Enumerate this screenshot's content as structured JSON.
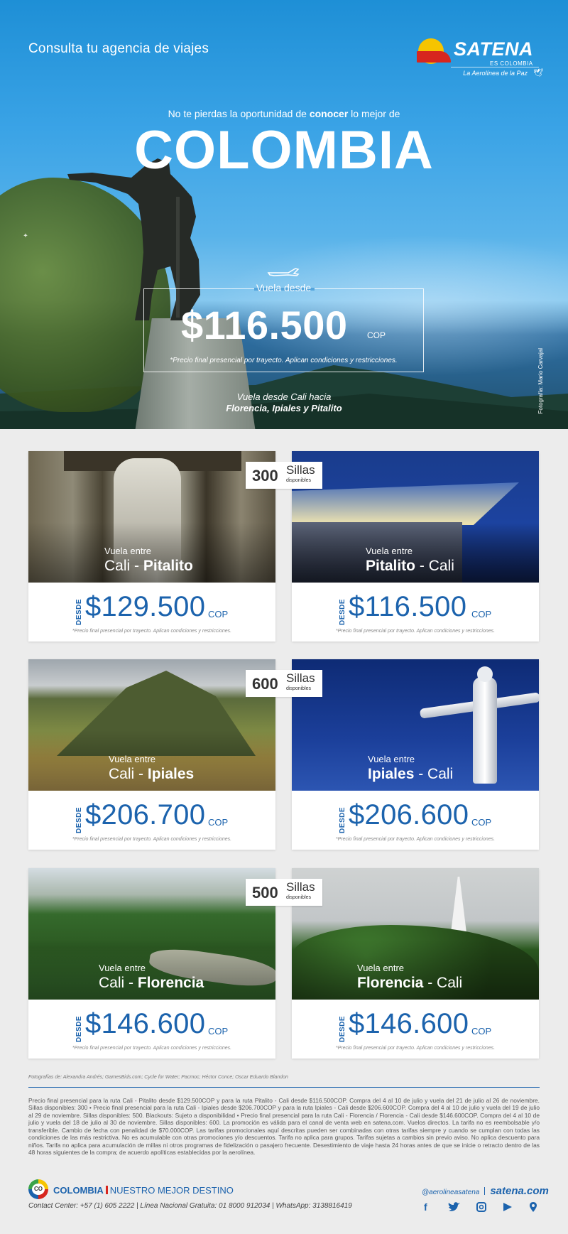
{
  "header": {
    "consulta": "Consulta tu agencia de viajes",
    "logo": {
      "name": "SATENA",
      "sub": "ES COLOMBIA",
      "tagline": "La Aerolínea de la Paz"
    },
    "subtitle_pre": "No te pierdas la oportunidad de ",
    "subtitle_bold": "conocer",
    "subtitle_post": " lo mejor de",
    "title": "COLOMBIA"
  },
  "hero_price": {
    "label": "Vuela desde",
    "amount": "$116.500",
    "currency": "COP",
    "note": "*Precio final presencial por trayecto. Aplican condiciones y restricciones.",
    "route_intro": "Vuela desde Cali hacia",
    "route_cities": "Florencia, Ipiales y Pitalito",
    "photo_credit": "Fotografía: Mario Carvajal"
  },
  "seats": [
    {
      "number": "300",
      "label": "Sillas",
      "sub": "disponibles"
    },
    {
      "number": "600",
      "label": "Sillas",
      "sub": "disponibles"
    },
    {
      "number": "500",
      "label": "Sillas",
      "sub": "disponibles"
    }
  ],
  "cards": [
    {
      "intro": "Vuela entre",
      "from": "Cali",
      "dash": " - ",
      "to": "Pitalito",
      "bold": "to",
      "desde": "DESDE",
      "price": "$129.500",
      "currency": "COP",
      "note": "*Precio final presencial por trayecto. Aplican condiciones y restricciones."
    },
    {
      "intro": "Vuela entre",
      "from": "Pitalito",
      "dash": " - ",
      "to": "Cali",
      "bold": "from",
      "desde": "DESDE",
      "price": "$116.500",
      "currency": "COP",
      "note": "*Precio final presencial por trayecto. Aplican condiciones y restricciones."
    },
    {
      "intro": "Vuela entre",
      "from": "Cali",
      "dash": " - ",
      "to": "Ipiales",
      "bold": "to",
      "desde": "DESDE",
      "price": "$206.700",
      "currency": "COP",
      "note": "*Precio final presencial por trayecto. Aplican condiciones y restricciones."
    },
    {
      "intro": "Vuela entre",
      "from": "Ipiales",
      "dash": " - ",
      "to": "Cali",
      "bold": "from",
      "desde": "DESDE",
      "price": "$206.600",
      "currency": "COP",
      "note": "*Precio final presencial por trayecto. Aplican condiciones y restricciones."
    },
    {
      "intro": "Vuela entre",
      "from": "Cali",
      "dash": " - ",
      "to": "Florencia",
      "bold": "to",
      "desde": "DESDE",
      "price": "$146.600",
      "currency": "COP",
      "note": "*Precio final presencial por trayecto. Aplican condiciones y restricciones."
    },
    {
      "intro": "Vuela entre",
      "from": "Florencia",
      "dash": " - ",
      "to": "Cali",
      "bold": "from",
      "desde": "DESDE",
      "price": "$146.600",
      "currency": "COP",
      "note": "*Precio final presencial por trayecto. Aplican condiciones y restricciones."
    }
  ],
  "footer": {
    "photos_credit": "Fotografías de: Alexandra Andrés; GamesBids.com; Cycle for Water; Pacmoc; Héctor Conce; Oscar Eduardo Blandon",
    "legal": "Precio final presencial para la ruta Cali - Pitalito desde $129.500COP y para la ruta Pitalito - Cali desde $116.500COP. Compra del 4 al 10 de julio y vuela del 21 de julio al 26 de noviembre. Sillas disponibles: 300 • Precio final presencial para la ruta Cali - Ipiales desde $206.700COP y para la ruta Ipiales - Cali desde $206.600COP. Compra del 4 al 10 de julio y vuela del 19 de julio al 29 de noviembre. Sillas disponibles: 500. Blackouts: Sujeto a disponibilidad • Precio final presencial para la ruta Cali - Florencia / Florencia - Cali desde $146.600COP. Compra del 4 al 10 de julio y vuela del 18 de julio al 30 de noviembre. Sillas disponibles: 600. La promoción es válida para el canal de venta web en satena.com. Vuelos directos. La tarifa no es reembolsable y/o transferible. Cambio de fecha con penalidad de $70.000COP. Las tarifas promocionales aquí descritas pueden ser combinadas con otras tarifas siempre y cuando se cumplan con todas las condiciones de las más restrictiva. No es acumulable con otras promociones y/o descuentos. Tarifa no aplica para grupos. Tarifas sujetas a cambios sin previo aviso. No aplica descuento para niños. Tarifa no aplica para acumulación de millas ni otros programas de fidelización o pasajero frecuente. Desestimiento de viaje hasta 24 horas antes de que se inicie o retracto dentro de las 48 horas siguientes de la compra; de acuerdo apolíticas establecidas por la aerolínea.",
    "brand_bold": "COLOMBIA",
    "brand_rest": "NUESTRO MEJOR DESTINO",
    "brand_badge": "CO",
    "contact": "Contact Center: +57 (1) 605 2222 | Línea Nacional Gratuita: 01 8000 912034 | WhatsApp: 3138816419",
    "handle": "@aerolineasatena",
    "site": "satena.com",
    "icons": [
      "facebook-icon",
      "twitter-icon",
      "instagram-icon",
      "youtube-icon",
      "location-icon"
    ]
  },
  "colors": {
    "brand_blue": "#1c63ad",
    "sky": "#3aa3e6",
    "accent_red": "#d7261e",
    "accent_yellow": "#f6c400"
  }
}
